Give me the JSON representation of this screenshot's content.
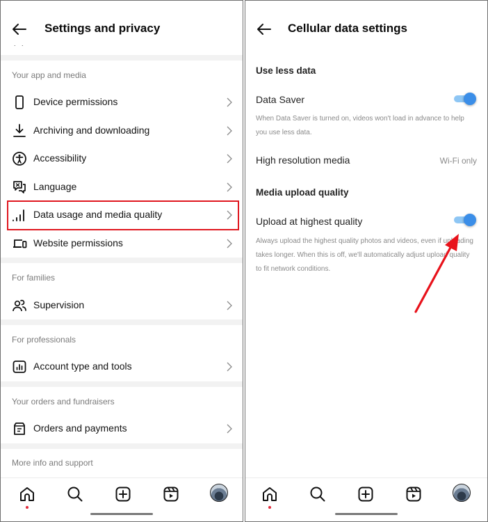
{
  "left_panel": {
    "title": "Settings and privacy",
    "truncated_row_hint": ". .",
    "sections": [
      {
        "heading": "Your app and media",
        "items": [
          {
            "label": "Device permissions",
            "icon": "phone-icon"
          },
          {
            "label": "Archiving and downloading",
            "icon": "download-icon"
          },
          {
            "label": "Accessibility",
            "icon": "accessibility-icon"
          },
          {
            "label": "Language",
            "icon": "translate-icon"
          },
          {
            "label": "Data usage and media quality",
            "icon": "signal-bars-icon",
            "highlighted": true
          },
          {
            "label": "Website permissions",
            "icon": "devices-icon"
          }
        ]
      },
      {
        "heading": "For families",
        "items": [
          {
            "label": "Supervision",
            "icon": "people-icon"
          }
        ]
      },
      {
        "heading": "For professionals",
        "items": [
          {
            "label": "Account type and tools",
            "icon": "chart-box-icon"
          }
        ]
      },
      {
        "heading": "Your orders and fundraisers",
        "items": [
          {
            "label": "Orders and payments",
            "icon": "receipt-box-icon"
          }
        ]
      },
      {
        "heading": "More info and support",
        "items": []
      }
    ],
    "highlight_color": "#e0161e"
  },
  "right_panel": {
    "title": "Cellular data settings",
    "use_less_data": {
      "heading": "Use less data",
      "data_saver_label": "Data Saver",
      "data_saver_on": true,
      "data_saver_help": "When Data Saver is turned on, videos won't load in advance to help you use less data.",
      "high_res_label": "High resolution media",
      "high_res_value": "Wi-Fi only"
    },
    "media_upload": {
      "heading": "Media upload quality",
      "upload_label": "Upload at highest quality",
      "upload_on": true,
      "upload_help": "Always upload the highest quality photos and videos, even if uploading takes longer. When this is off, we'll automatically adjust upload quality to fit network conditions."
    },
    "toggle_color": "#3b8ee8",
    "annotation_arrow_color": "#e8121b"
  },
  "bottom_nav": {
    "items": [
      {
        "name": "home",
        "icon": "home-icon",
        "active": true
      },
      {
        "name": "search",
        "icon": "search-icon"
      },
      {
        "name": "create",
        "icon": "plus-square-icon"
      },
      {
        "name": "reels",
        "icon": "reels-icon"
      },
      {
        "name": "profile",
        "icon": "avatar"
      }
    ]
  }
}
